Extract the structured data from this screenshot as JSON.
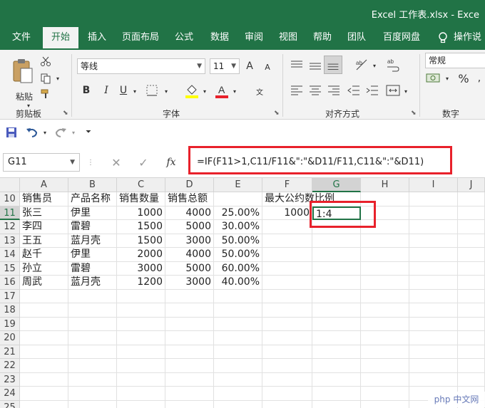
{
  "title_bar": {
    "title": "Excel 工作表.xlsx  -  Exce"
  },
  "tabs": [
    "文件",
    "开始",
    "插入",
    "页面布局",
    "公式",
    "数据",
    "审阅",
    "视图",
    "帮助",
    "团队",
    "百度网盘",
    "操作说"
  ],
  "active_tab": "开始",
  "ribbon": {
    "clipboard": {
      "paste_label": "粘贴",
      "group_label": "剪贴板"
    },
    "font": {
      "name": "等线",
      "size": "11",
      "group_label": "字体",
      "bold": "B",
      "italic": "I",
      "underline": "U",
      "grow": "A",
      "shrink": "A"
    },
    "alignment": {
      "group_label": "对齐方式"
    },
    "number": {
      "format": "常规",
      "group_label": "数字",
      "percent": "%"
    }
  },
  "formula_bar": {
    "name_box": "G11",
    "formula": "=IF(F11>1,C11/F11&\":\"&D11/F11,C11&\":\"&D11)",
    "fx": "fx"
  },
  "sheet": {
    "columns": [
      "A",
      "B",
      "C",
      "D",
      "E",
      "F",
      "G",
      "H",
      "I",
      "J"
    ],
    "rows": [
      "10",
      "11",
      "12",
      "13",
      "14",
      "15",
      "16",
      "17",
      "18",
      "19",
      "20",
      "21",
      "22",
      "23",
      "24",
      "25"
    ],
    "cells": {
      "A10": "销售员",
      "B10": "产品名称",
      "C10": "销售数量",
      "D10": "销售总额",
      "F10": "最大公约数",
      "G10": "比例",
      "A11": "张三",
      "B11": "伊里",
      "C11": "1000",
      "D11": "4000",
      "E11": "25.00%",
      "F11": "1000",
      "G11": "1:4",
      "A12": "李四",
      "B12": "雷碧",
      "C12": "1500",
      "D12": "5000",
      "E12": "30.00%",
      "A13": "王五",
      "B13": "蓝月壳",
      "C13": "1500",
      "D13": "3000",
      "E13": "50.00%",
      "A14": "赵千",
      "B14": "伊里",
      "C14": "2000",
      "D14": "4000",
      "E14": "50.00%",
      "A15": "孙立",
      "B15": "雷碧",
      "C15": "3000",
      "D15": "5000",
      "E15": "60.00%",
      "A16": "周武",
      "B16": "蓝月壳",
      "C16": "1200",
      "D16": "3000",
      "E16": "40.00%"
    },
    "active_cell": "G11"
  },
  "watermark": {
    "text": "php 中文网"
  },
  "colors": {
    "excel_green": "#217346",
    "highlight_red": "#e8212b"
  }
}
